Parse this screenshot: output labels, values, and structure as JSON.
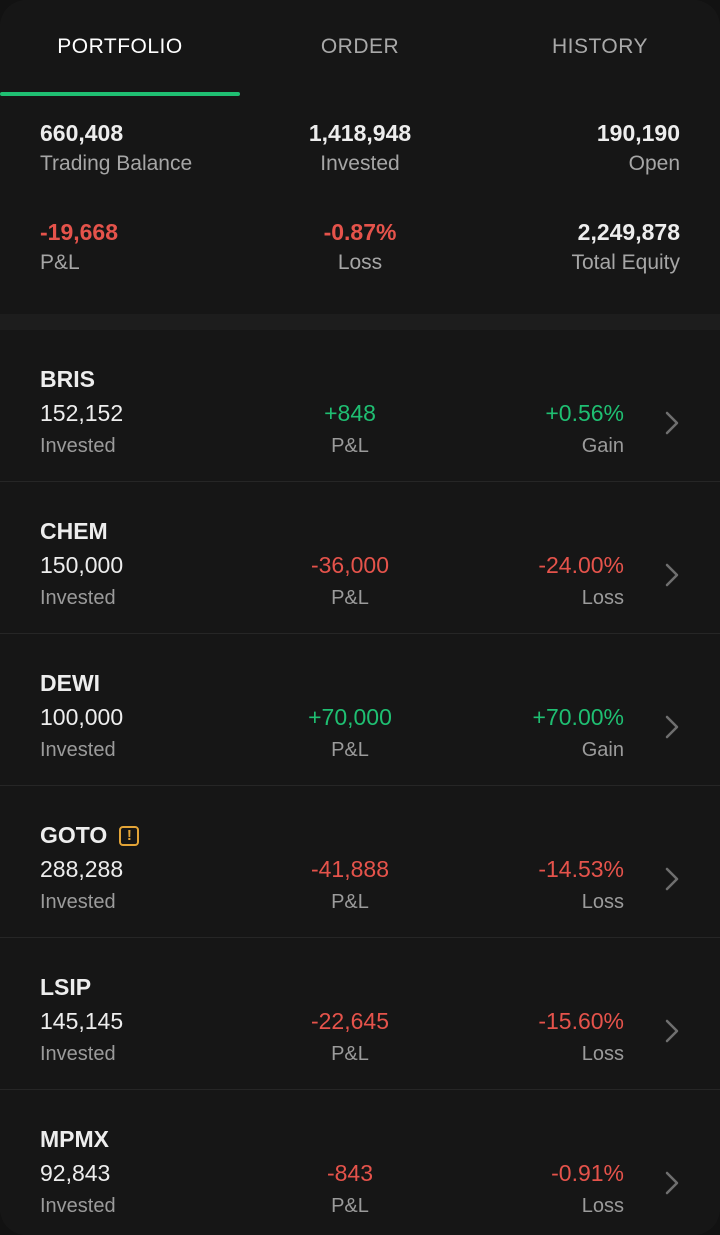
{
  "tabs": [
    {
      "label": "PORTFOLIO",
      "active": true
    },
    {
      "label": "ORDER",
      "active": false
    },
    {
      "label": "HISTORY",
      "active": false
    }
  ],
  "summary": {
    "trading_balance": {
      "value": "660,408",
      "label": "Trading Balance"
    },
    "invested": {
      "value": "1,418,948",
      "label": "Invested"
    },
    "open": {
      "value": "190,190",
      "label": "Open"
    },
    "pnl": {
      "value": "-19,668",
      "label": "P&L"
    },
    "loss": {
      "value": "-0.87%",
      "label": "Loss"
    },
    "total_equity": {
      "value": "2,249,878",
      "label": "Total Equity"
    }
  },
  "holdings": [
    {
      "ticker": "BRIS",
      "warning": false,
      "invested": "152,152",
      "invested_label": "Invested",
      "pnl": "+848",
      "pnl_label": "P&L",
      "pct": "+0.56%",
      "pct_label": "Gain",
      "direction": "pos"
    },
    {
      "ticker": "CHEM",
      "warning": false,
      "invested": "150,000",
      "invested_label": "Invested",
      "pnl": "-36,000",
      "pnl_label": "P&L",
      "pct": "-24.00%",
      "pct_label": "Loss",
      "direction": "neg"
    },
    {
      "ticker": "DEWI",
      "warning": false,
      "invested": "100,000",
      "invested_label": "Invested",
      "pnl": "+70,000",
      "pnl_label": "P&L",
      "pct": "+70.00%",
      "pct_label": "Gain",
      "direction": "pos"
    },
    {
      "ticker": "GOTO",
      "warning": true,
      "warning_glyph": "!",
      "invested": "288,288",
      "invested_label": "Invested",
      "pnl": "-41,888",
      "pnl_label": "P&L",
      "pct": "-14.53%",
      "pct_label": "Loss",
      "direction": "neg"
    },
    {
      "ticker": "LSIP",
      "warning": false,
      "invested": "145,145",
      "invested_label": "Invested",
      "pnl": "-22,645",
      "pnl_label": "P&L",
      "pct": "-15.60%",
      "pct_label": "Loss",
      "direction": "neg"
    },
    {
      "ticker": "MPMX",
      "warning": false,
      "invested": "92,843",
      "invested_label": "Invested",
      "pnl": "-843",
      "pnl_label": "P&L",
      "pct": "-0.91%",
      "pct_label": "Loss",
      "direction": "neg"
    }
  ],
  "colors": {
    "accent": "#1fbf72",
    "gain": "#1fbf72",
    "loss": "#e5534b",
    "warning": "#e3a437",
    "background": "#161616"
  },
  "icons": {
    "row_chevron": "chevron-right-icon",
    "warning": "warning-badge-icon"
  }
}
